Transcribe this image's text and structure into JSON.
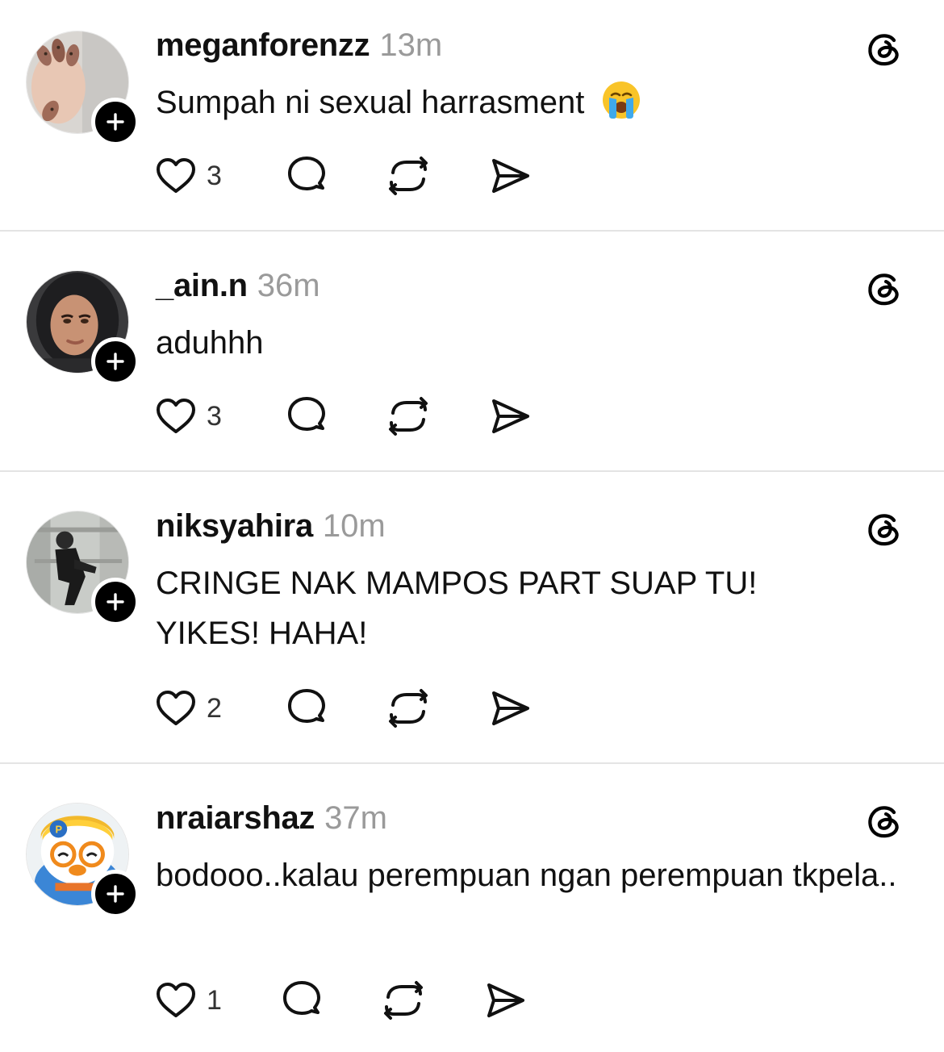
{
  "posts": [
    {
      "username": "meganforenzz",
      "time": "13m",
      "text": "Sumpah ni sexual harrasment",
      "has_emoji": true,
      "emoji": "loudly-crying-face",
      "likes": "3",
      "avatar": "nails-photo"
    },
    {
      "username": "_ain.n",
      "time": "36m",
      "text": "aduhhh",
      "has_emoji": false,
      "likes": "3",
      "avatar": "hijab-portrait"
    },
    {
      "username": "niksyahira",
      "time": "10m",
      "text": "CRINGE NAK MAMPOS PART SUAP TU! YIKES! HAHA!",
      "has_emoji": false,
      "likes": "2",
      "avatar": "person-in-alley"
    },
    {
      "username": "nraiarshaz",
      "time": "37m",
      "text": "bodooo..kalau perempuan ngan perempuan tkpela..",
      "has_emoji": false,
      "likes": "1",
      "avatar": "cartoon-penguin"
    }
  ],
  "icons": {
    "like": "heart-icon",
    "reply": "comment-bubble-icon",
    "repost": "repost-icon",
    "share": "send-icon",
    "brand": "threads-logo-icon",
    "follow": "plus-icon"
  },
  "colors": {
    "text": "#111111",
    "muted": "#9a9a9a",
    "divider": "#e4e4e4",
    "follow_badge": "#000000"
  }
}
